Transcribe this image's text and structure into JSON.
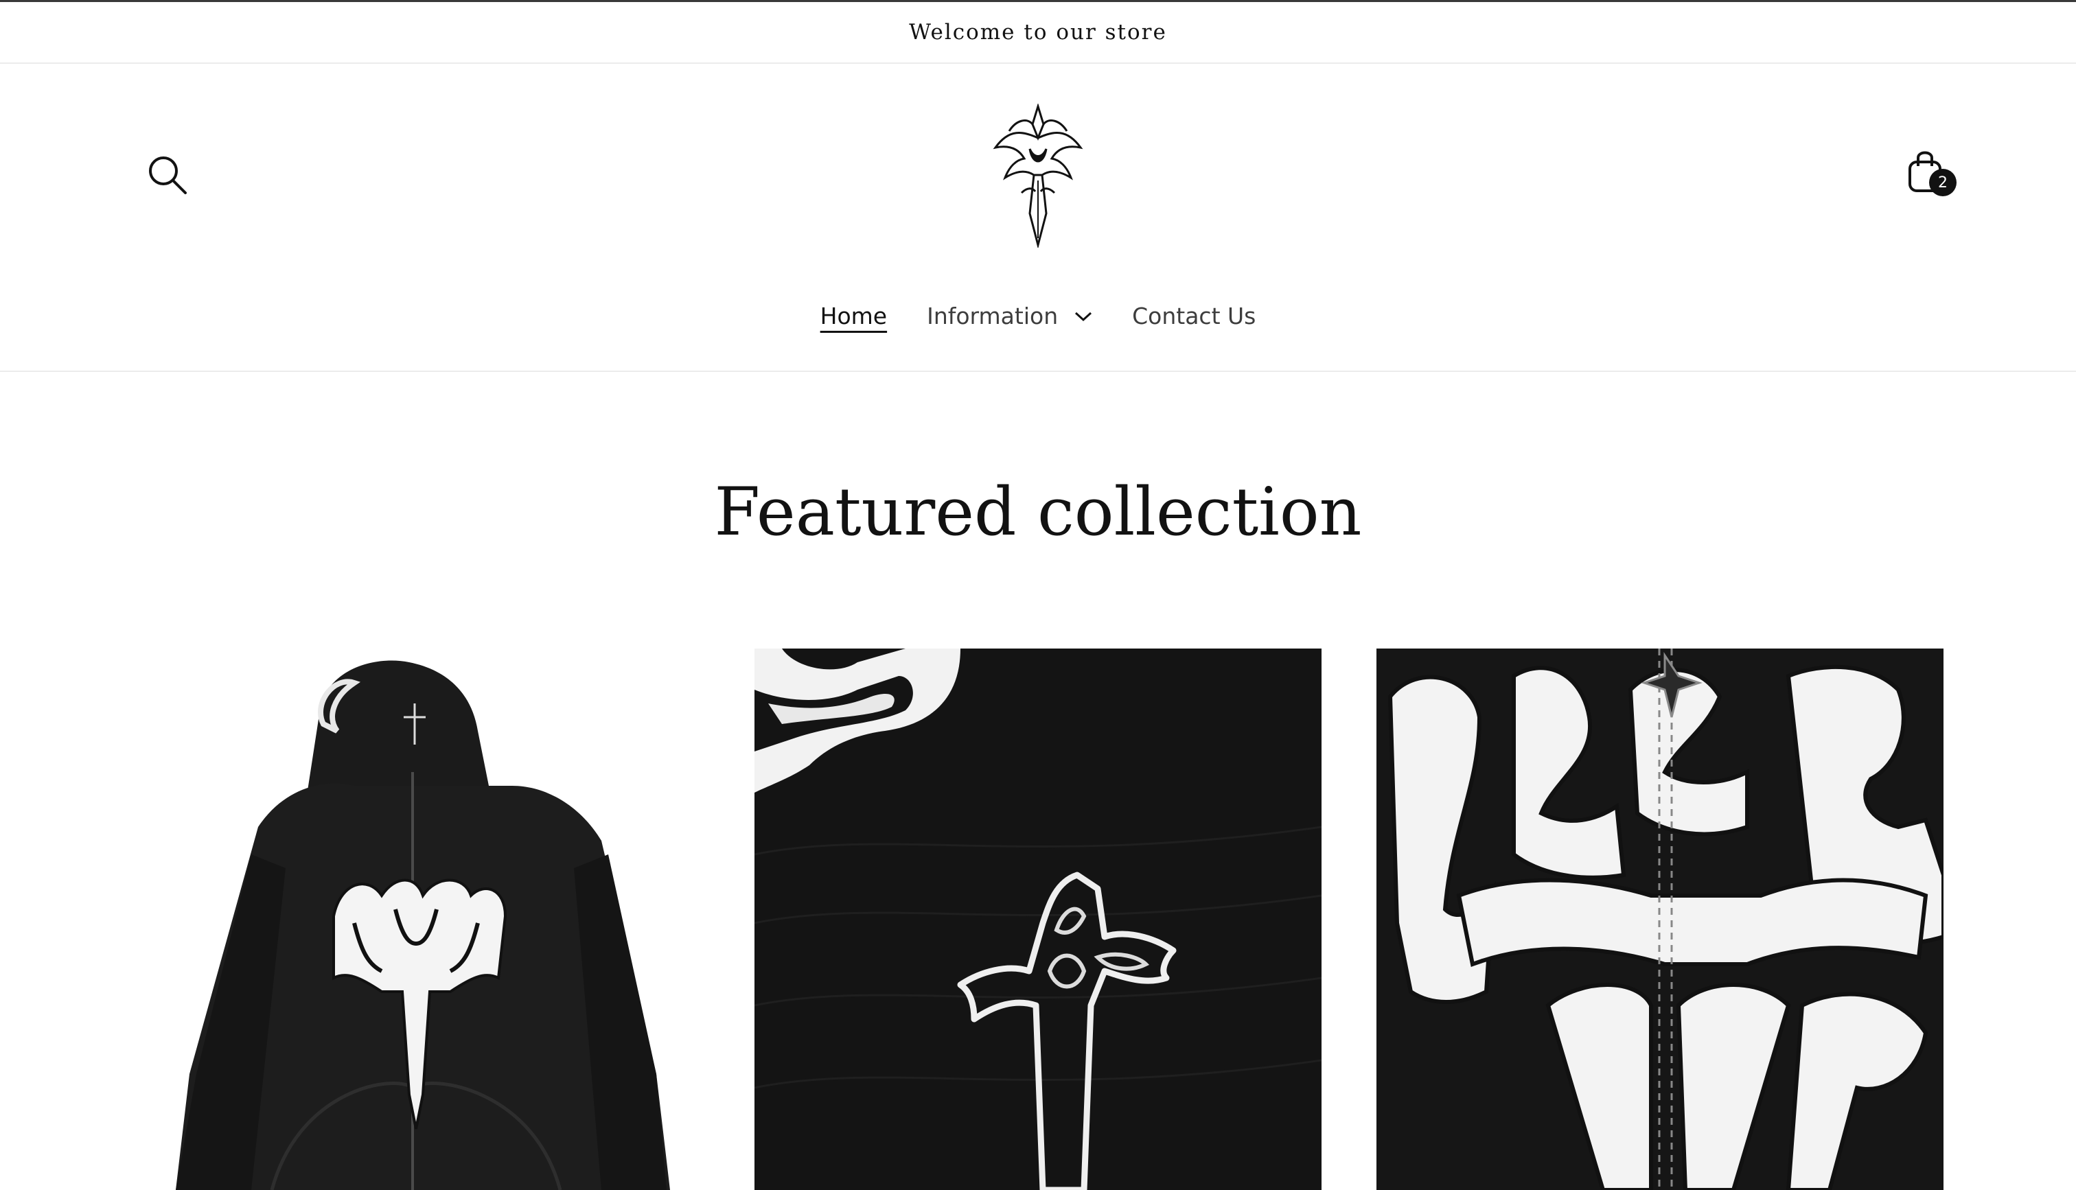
{
  "announcement": {
    "text": "Welcome to our store"
  },
  "header": {
    "search_icon": "search-icon",
    "logo": "gothic-cross-logo",
    "cart": {
      "icon": "bag-icon",
      "count": "2"
    }
  },
  "nav": {
    "items": [
      {
        "label": "Home",
        "active": true
      },
      {
        "label": "Information",
        "has_dropdown": true
      },
      {
        "label": "Contact Us"
      }
    ]
  },
  "featured": {
    "title": "Featured collection",
    "products": [
      {
        "image": "black zip hoodie with white gothic cross graphic"
      },
      {
        "image": "close-up of embroidered cross on black fabric"
      },
      {
        "image": "close-up of white graphic and zipper on black hoodie"
      }
    ]
  },
  "colors": {
    "text": "#121212",
    "background": "#ffffff",
    "border": "#ececec"
  }
}
